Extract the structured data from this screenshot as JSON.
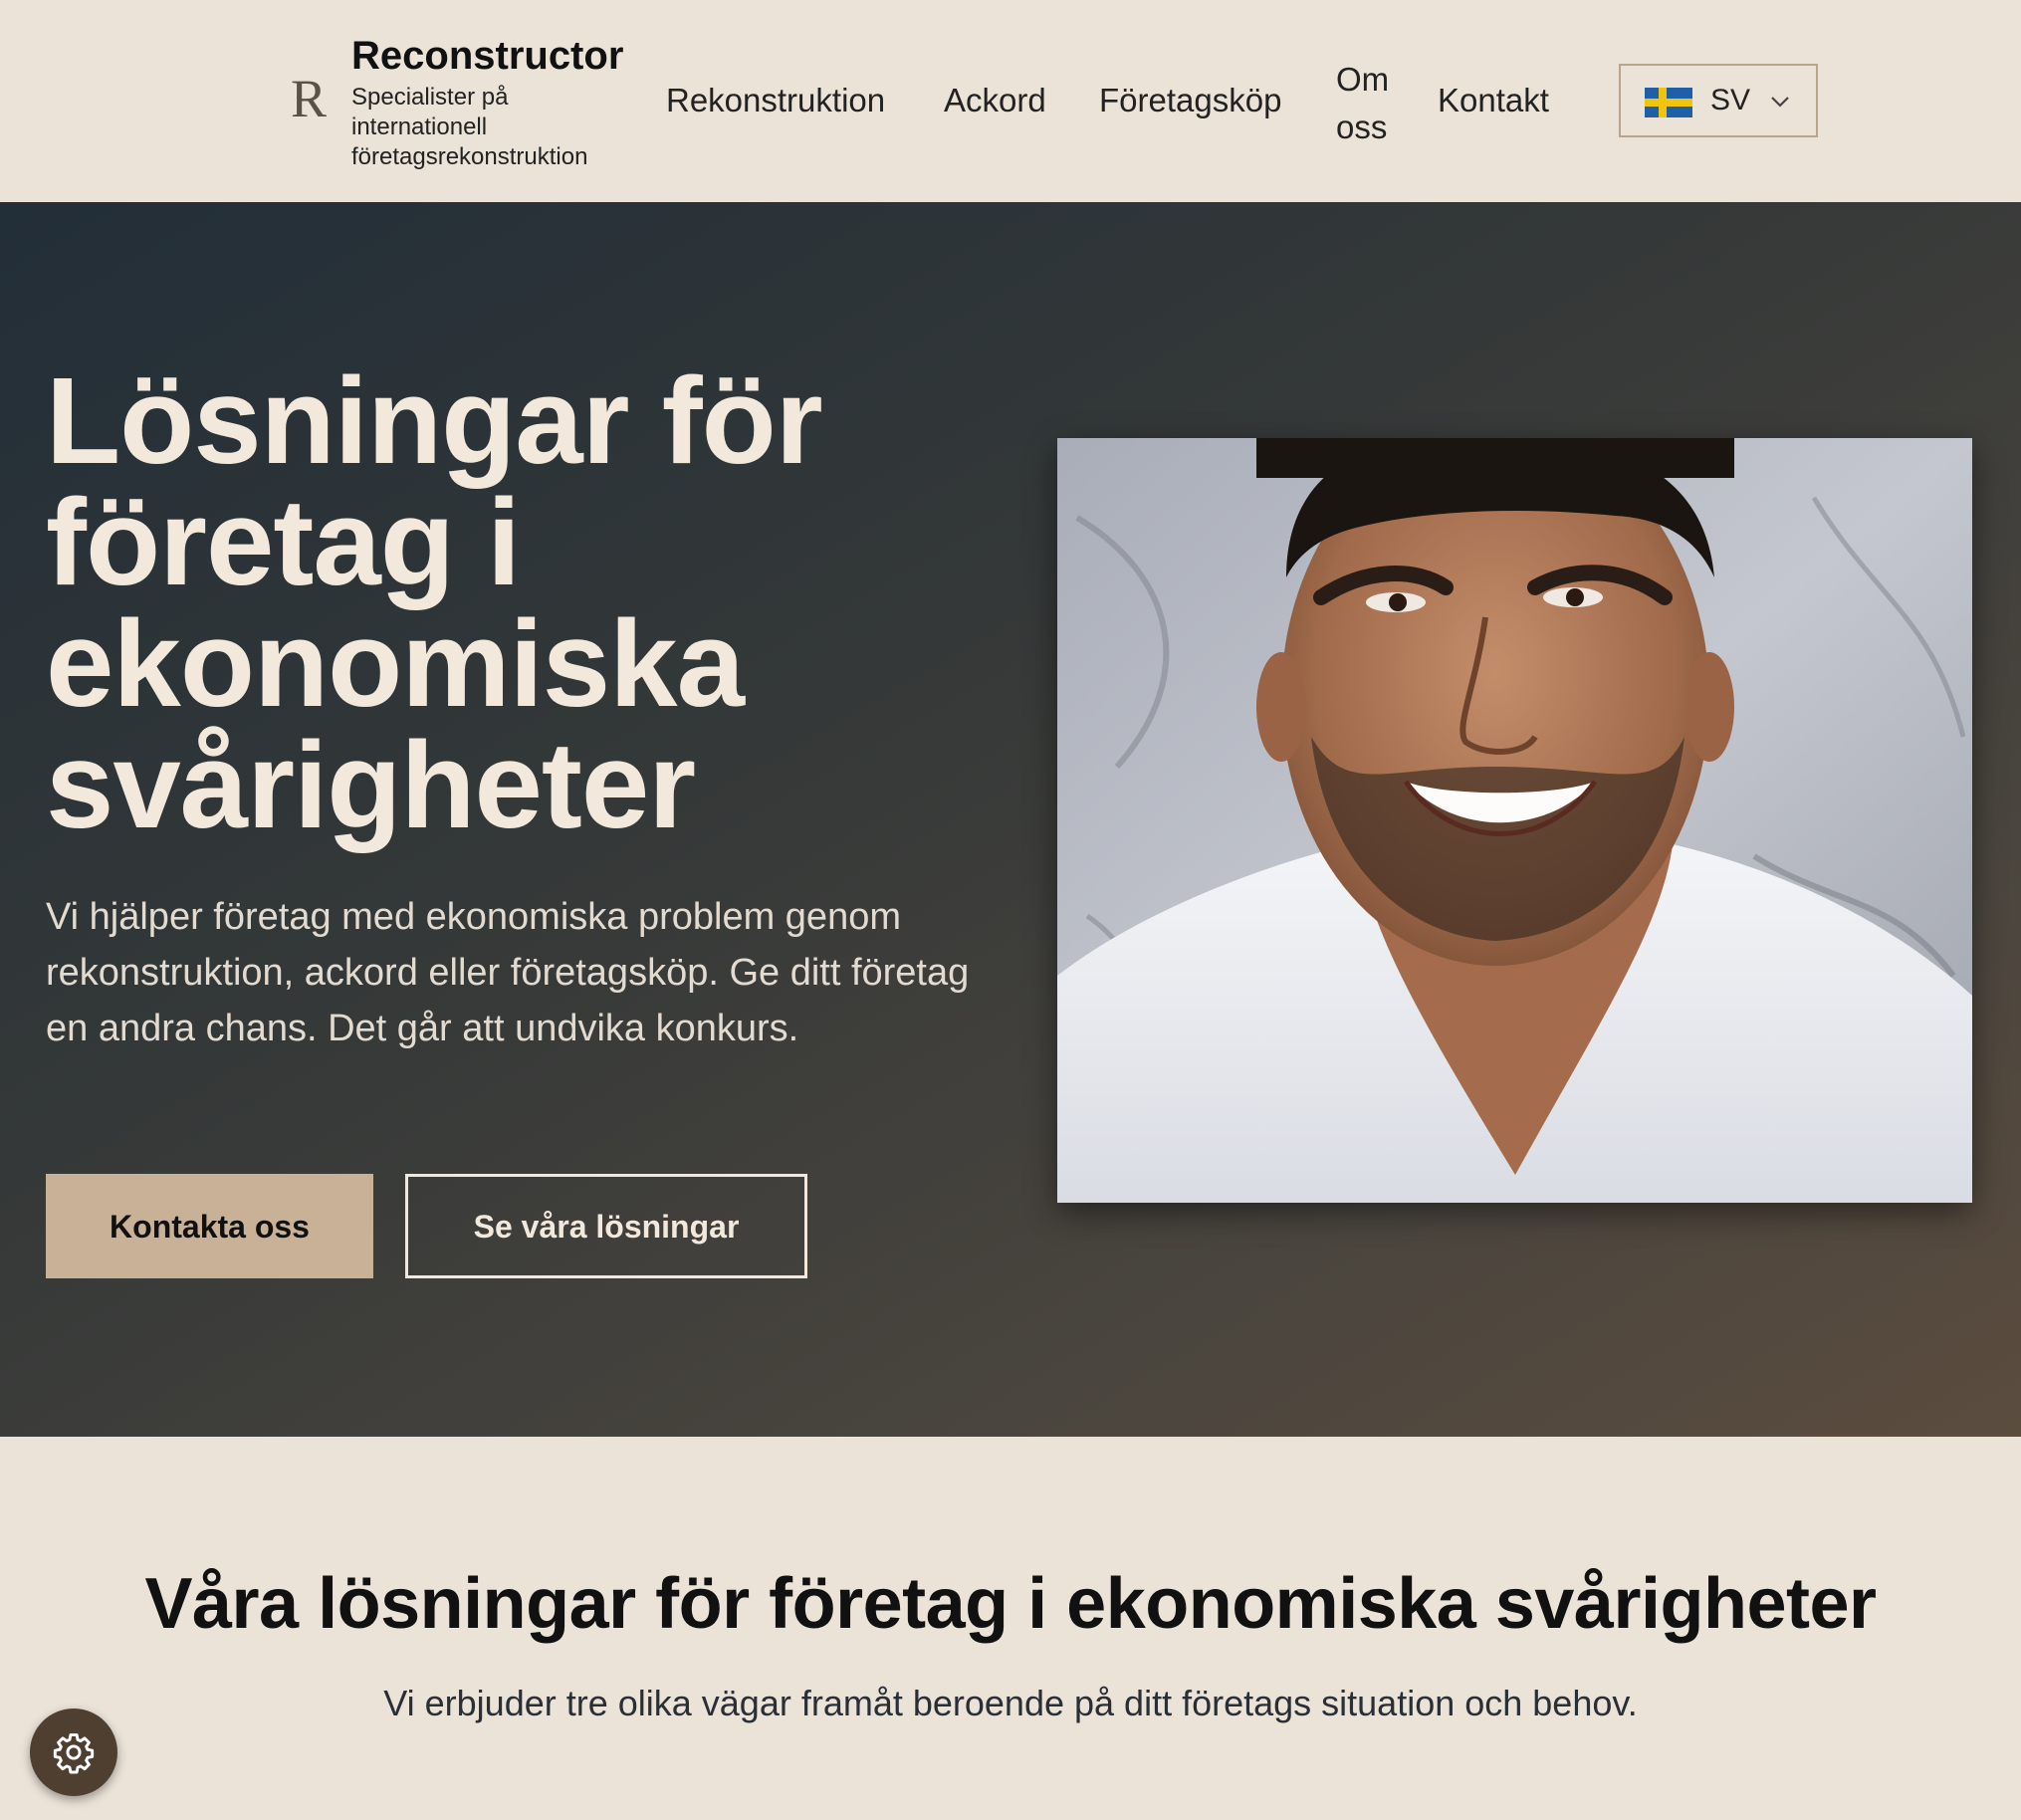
{
  "header": {
    "logo_mark": "R",
    "brand_name": "Reconstructor",
    "tagline": "Specialister på internationell företagsrekonstruktion",
    "nav": {
      "rekonstruktion": "Rekonstruktion",
      "ackord": "Ackord",
      "foretagskop": "Företagsköp",
      "om_oss": "Om oss",
      "kontakt": "Kontakt"
    },
    "language": {
      "flag_icon": "sweden-flag-icon",
      "code": "SV"
    }
  },
  "hero": {
    "title": "Lösningar för företag i ekonomiska svårigheter",
    "lead": "Vi hjälper företag med ekonomiska problem genom rekonstruktion, ackord eller företagsköp. Ge ditt företag en andra chans. Det går att undvika konkurs.",
    "primary_cta": "Kontakta oss",
    "secondary_cta": "Se våra lösningar"
  },
  "solutions": {
    "title": "Våra lösningar för företag i ekonomiska svårigheter",
    "subtitle": "Vi erbjuder tre olika vägar framåt beroende på ditt företags situation och behov."
  },
  "floating": {
    "settings_icon": "gear-icon"
  },
  "colors": {
    "page_bg": "#ebe3d8",
    "hero_text": "#f2e8dc",
    "accent": "#c9b197",
    "settings_bg": "#4e3f31"
  }
}
